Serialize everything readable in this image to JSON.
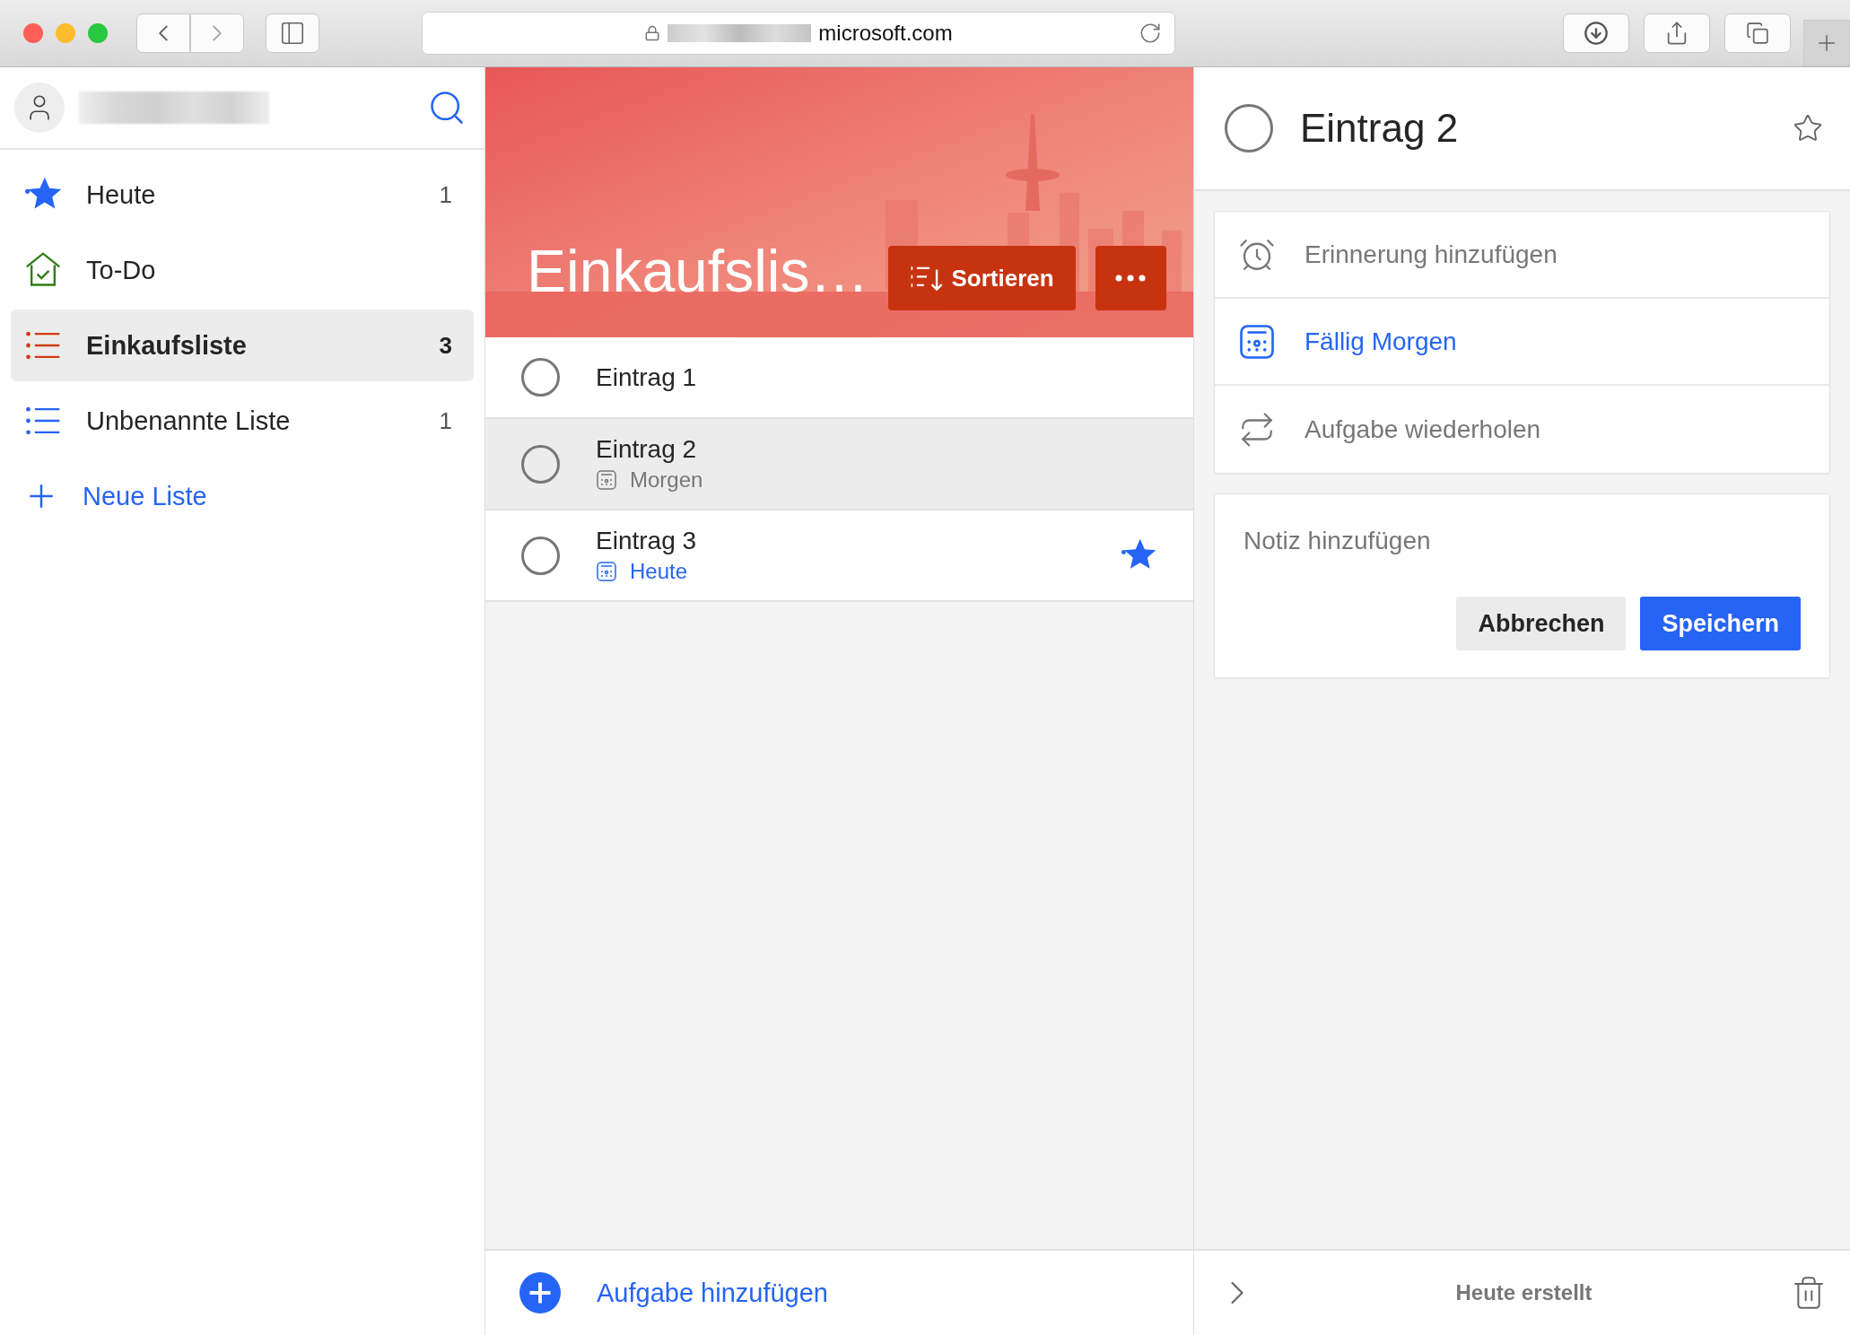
{
  "browser": {
    "url": "microsoft.com"
  },
  "sidebar": {
    "items": [
      {
        "label": "Heute",
        "count": "1",
        "kind": "star",
        "color": "#2564f5",
        "selected": false
      },
      {
        "label": "To-Do",
        "kind": "home",
        "color": "#2f7d16",
        "selected": false
      },
      {
        "label": "Einkaufsliste",
        "count": "3",
        "kind": "list",
        "color": "#d13b12",
        "selected": true
      },
      {
        "label": "Unbenannte Liste",
        "count": "1",
        "kind": "list",
        "color": "#2564f5",
        "selected": false
      }
    ],
    "new_list": "Neue Liste"
  },
  "list": {
    "title": "Einkaufslis…",
    "sort_button": "Sortieren",
    "tasks": [
      {
        "title": "Eintrag 1",
        "checked": false,
        "selected": false,
        "starred": false
      },
      {
        "title": "Eintrag 2",
        "checked": false,
        "due": "Morgen",
        "due_today": false,
        "selected": true,
        "starred": false
      },
      {
        "title": "Eintrag 3",
        "checked": false,
        "due": "Heute",
        "due_today": true,
        "selected": false,
        "starred": true
      }
    ],
    "add_task": "Aufgabe hinzufügen"
  },
  "detail": {
    "title": "Eintrag 2",
    "checked": false,
    "starred": false,
    "options": [
      {
        "kind": "reminder",
        "label": "Erinnerung hinzufügen",
        "active": false
      },
      {
        "kind": "due",
        "label": "Fällig Morgen",
        "active": true
      },
      {
        "kind": "repeat",
        "label": "Aufgabe wiederholen",
        "active": false
      }
    ],
    "note": {
      "placeholder": "Notiz hinzufügen"
    },
    "buttons": [
      {
        "label": "Abbrechen",
        "kind": "secondary"
      },
      {
        "label": "Speichern",
        "kind": "primary"
      }
    ],
    "footer": "Heute erstellt"
  }
}
